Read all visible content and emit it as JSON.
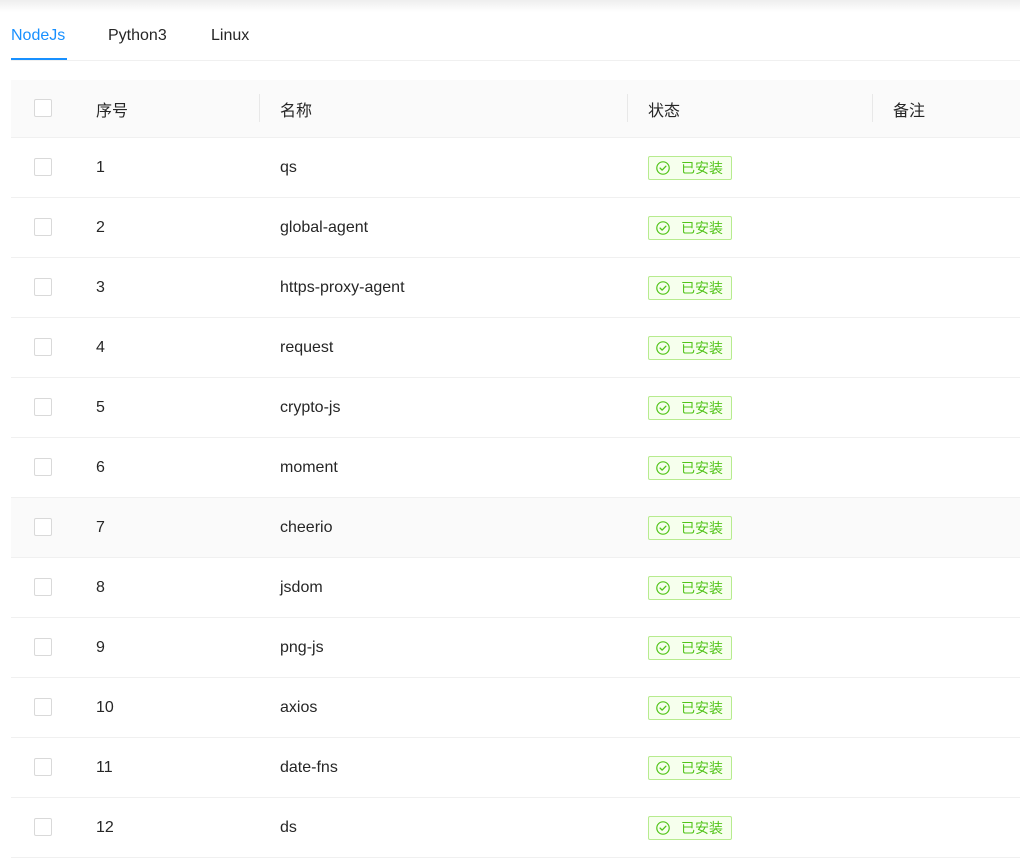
{
  "tabs": [
    {
      "label": "NodeJs",
      "active": true
    },
    {
      "label": "Python3",
      "active": false
    },
    {
      "label": "Linux",
      "active": false
    }
  ],
  "table": {
    "columns": [
      "序号",
      "名称",
      "状态",
      "备注"
    ],
    "rows": [
      {
        "index": "1",
        "name": "qs",
        "status": "已安装",
        "note": ""
      },
      {
        "index": "2",
        "name": "global-agent",
        "status": "已安装",
        "note": ""
      },
      {
        "index": "3",
        "name": "https-proxy-agent",
        "status": "已安装",
        "note": ""
      },
      {
        "index": "4",
        "name": "request",
        "status": "已安装",
        "note": ""
      },
      {
        "index": "5",
        "name": "crypto-js",
        "status": "已安装",
        "note": ""
      },
      {
        "index": "6",
        "name": "moment",
        "status": "已安装",
        "note": ""
      },
      {
        "index": "7",
        "name": "cheerio",
        "status": "已安装",
        "note": ""
      },
      {
        "index": "8",
        "name": "jsdom",
        "status": "已安装",
        "note": ""
      },
      {
        "index": "9",
        "name": "png-js",
        "status": "已安装",
        "note": ""
      },
      {
        "index": "10",
        "name": "axios",
        "status": "已安装",
        "note": ""
      },
      {
        "index": "11",
        "name": "date-fns",
        "status": "已安装",
        "note": ""
      },
      {
        "index": "12",
        "name": "ds",
        "status": "已安装",
        "note": ""
      }
    ]
  },
  "icons": {
    "status": "check-circle-icon"
  },
  "colors": {
    "accent": "#1890ff",
    "success": "#52c41a",
    "success_bg": "#f6ffed",
    "success_border": "#b7eb8f"
  }
}
